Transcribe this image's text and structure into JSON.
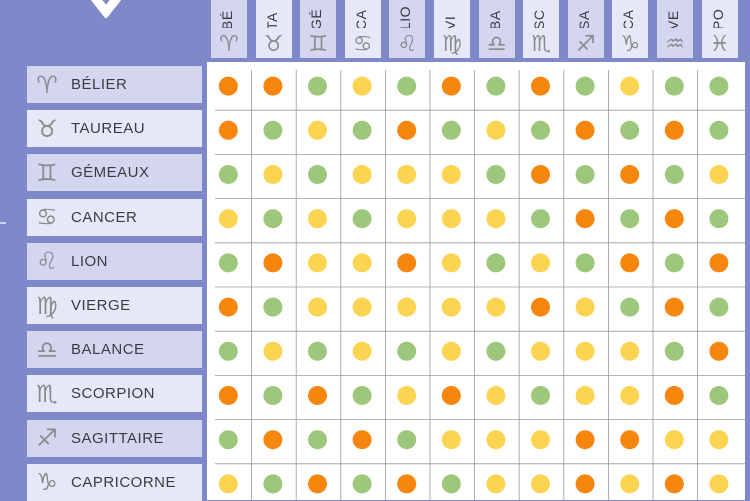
{
  "chart_data": {
    "type": "heatmap",
    "title": "",
    "legend": {
      "orange": "#f7860f",
      "green": "#9dc77a",
      "yellow": "#fdd452"
    },
    "columns": [
      {
        "label": "BÉLIER",
        "visible_text": "BÉ",
        "symbol": "♈"
      },
      {
        "label": "TAUREAU",
        "visible_text": "TA",
        "symbol": "♉"
      },
      {
        "label": "GÉMEAUX",
        "visible_text": "GÉ",
        "symbol": "♊"
      },
      {
        "label": "CANCER",
        "visible_text": "CA",
        "symbol": "♋"
      },
      {
        "label": "LION",
        "visible_text": "LIO",
        "symbol": "♌"
      },
      {
        "label": "VIERGE",
        "visible_text": "VI",
        "symbol": "♍"
      },
      {
        "label": "BALANCE",
        "visible_text": "BA",
        "symbol": "♎"
      },
      {
        "label": "SCORPION",
        "visible_text": "SC",
        "symbol": "♏"
      },
      {
        "label": "SAGITTAIRE",
        "visible_text": "SA",
        "symbol": "♐"
      },
      {
        "label": "CAPRICORNE",
        "visible_text": "CA",
        "symbol": "♑"
      },
      {
        "label": "VERSEAU",
        "visible_text": "VE",
        "symbol": "♒"
      },
      {
        "label": "POISSONS",
        "visible_text": "PO",
        "symbol": "♓"
      }
    ],
    "rows": [
      {
        "label": "BÉLIER",
        "symbol": "♈",
        "values": [
          "orange",
          "orange",
          "green",
          "yellow",
          "green",
          "orange",
          "green",
          "orange",
          "green",
          "yellow",
          "green",
          "green"
        ]
      },
      {
        "label": "TAUREAU",
        "symbol": "♉",
        "values": [
          "orange",
          "green",
          "yellow",
          "green",
          "orange",
          "green",
          "yellow",
          "green",
          "orange",
          "green",
          "orange",
          "green"
        ]
      },
      {
        "label": "GÉMEAUX",
        "symbol": "♊",
        "values": [
          "green",
          "yellow",
          "green",
          "yellow",
          "yellow",
          "yellow",
          "green",
          "orange",
          "green",
          "orange",
          "green",
          "yellow"
        ]
      },
      {
        "label": "CANCER",
        "symbol": "♋",
        "values": [
          "yellow",
          "green",
          "yellow",
          "green",
          "yellow",
          "yellow",
          "yellow",
          "green",
          "orange",
          "green",
          "orange",
          "green"
        ]
      },
      {
        "label": "LION",
        "symbol": "♌",
        "values": [
          "green",
          "orange",
          "yellow",
          "yellow",
          "orange",
          "yellow",
          "green",
          "yellow",
          "green",
          "orange",
          "green",
          "orange"
        ]
      },
      {
        "label": "VIERGE",
        "symbol": "♍",
        "values": [
          "orange",
          "green",
          "yellow",
          "yellow",
          "yellow",
          "yellow",
          "yellow",
          "orange",
          "yellow",
          "green",
          "orange",
          "green"
        ]
      },
      {
        "label": "BALANCE",
        "symbol": "♎",
        "values": [
          "green",
          "yellow",
          "green",
          "yellow",
          "green",
          "yellow",
          "green",
          "yellow",
          "yellow",
          "yellow",
          "green",
          "orange"
        ]
      },
      {
        "label": "SCORPION",
        "symbol": "♏",
        "values": [
          "orange",
          "green",
          "orange",
          "green",
          "yellow",
          "orange",
          "yellow",
          "green",
          "yellow",
          "yellow",
          "orange",
          "green"
        ]
      },
      {
        "label": "SAGITTAIRE",
        "symbol": "♐",
        "values": [
          "green",
          "orange",
          "green",
          "orange",
          "green",
          "yellow",
          "yellow",
          "yellow",
          "orange",
          "orange",
          "yellow",
          "yellow"
        ]
      },
      {
        "label": "CAPRICORNE",
        "symbol": "♑",
        "values": [
          "yellow",
          "green",
          "orange",
          "green",
          "orange",
          "green",
          "yellow",
          "yellow",
          "orange",
          "yellow",
          "orange",
          "yellow"
        ]
      }
    ]
  },
  "theme": {
    "background": "#7f88c8",
    "grid_line": "#9a9aa2"
  }
}
